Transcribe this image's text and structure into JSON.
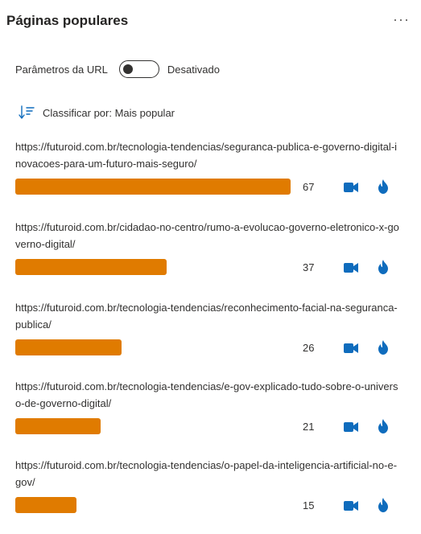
{
  "header": {
    "title": "Páginas populares",
    "more": "···"
  },
  "url_params": {
    "label": "Parâmetros da URL",
    "state": "Desativado",
    "enabled": false
  },
  "sort": {
    "label": "Classificar por: Mais popular"
  },
  "colors": {
    "bar": "#e07b00",
    "icon": "#0f6cbd"
  },
  "items": [
    {
      "url": "https://futuroid.com.br/tecnologia-tendencias/seguranca-publica-e-governo-digital-inovacoes-para-um-futuro-mais-seguro/",
      "count": "67"
    },
    {
      "url": "https://futuroid.com.br/cidadao-no-centro/rumo-a-evolucao-governo-eletronico-x-governo-digital/",
      "count": "37"
    },
    {
      "url": "https://futuroid.com.br/tecnologia-tendencias/reconhecimento-facial-na-seguranca-publica/",
      "count": "26"
    },
    {
      "url": "https://futuroid.com.br/tecnologia-tendencias/e-gov-explicado-tudo-sobre-o-universo-de-governo-digital/",
      "count": "21"
    },
    {
      "url": "https://futuroid.com.br/tecnologia-tendencias/o-papel-da-inteligencia-artificial-no-e-gov/",
      "count": "15"
    }
  ]
}
